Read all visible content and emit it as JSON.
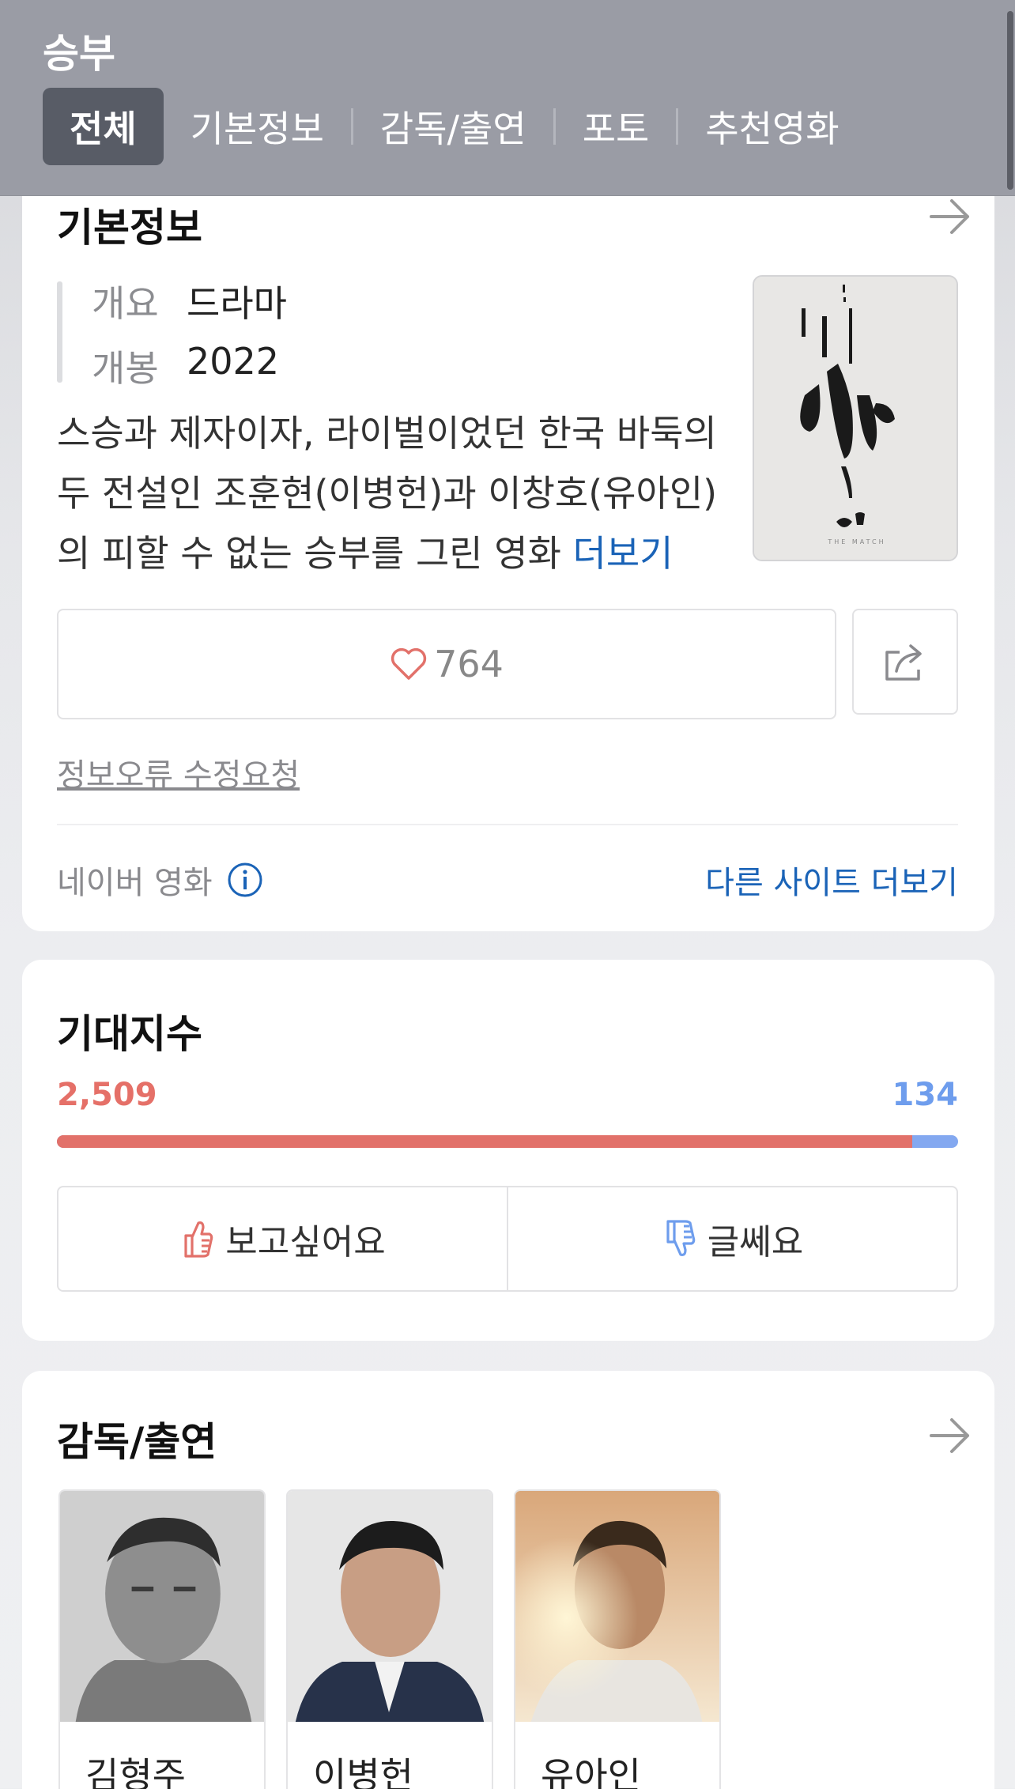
{
  "header": {
    "title": "승부",
    "tabs": [
      "전체",
      "기본정보",
      "감독/출연",
      "포토",
      "추천영화"
    ],
    "active_tab": "전체"
  },
  "basic_info": {
    "title": "기본정보",
    "rows": [
      {
        "label": "개요",
        "value": "드라마"
      },
      {
        "label": "개봉",
        "value": "2022"
      }
    ],
    "description_lines": [
      "스승과 제자이자, 라이벌이었던 한국 바둑의",
      "두 전설인 조훈현(이병헌)과 이창호(유아인)",
      "의 피할 수 없는 승부를 그린 영화"
    ],
    "more_link": "더보기",
    "poster_text": "THE MATCH",
    "like_count": "764",
    "report_link": "정보오류 수정요청",
    "source": "네이버 영화",
    "other_sites_link": "다른 사이트 더보기"
  },
  "expectation": {
    "title": "기대지수",
    "want_count": "2,509",
    "not_sure_count": "134",
    "want_fraction": 0.949,
    "want_label": "보고싶어요",
    "not_sure_label": "글쎄요"
  },
  "cast": {
    "title": "감독/출연",
    "people": [
      {
        "name": "김형주"
      },
      {
        "name": "이병헌"
      },
      {
        "name": "유아인"
      }
    ]
  },
  "colors": {
    "header_bg": "#9a9ca5",
    "active_tab_bg": "#585c66",
    "link_blue": "#1a63b7",
    "want_red": "#e2716a",
    "not_sure_blue": "#83a8f0"
  }
}
